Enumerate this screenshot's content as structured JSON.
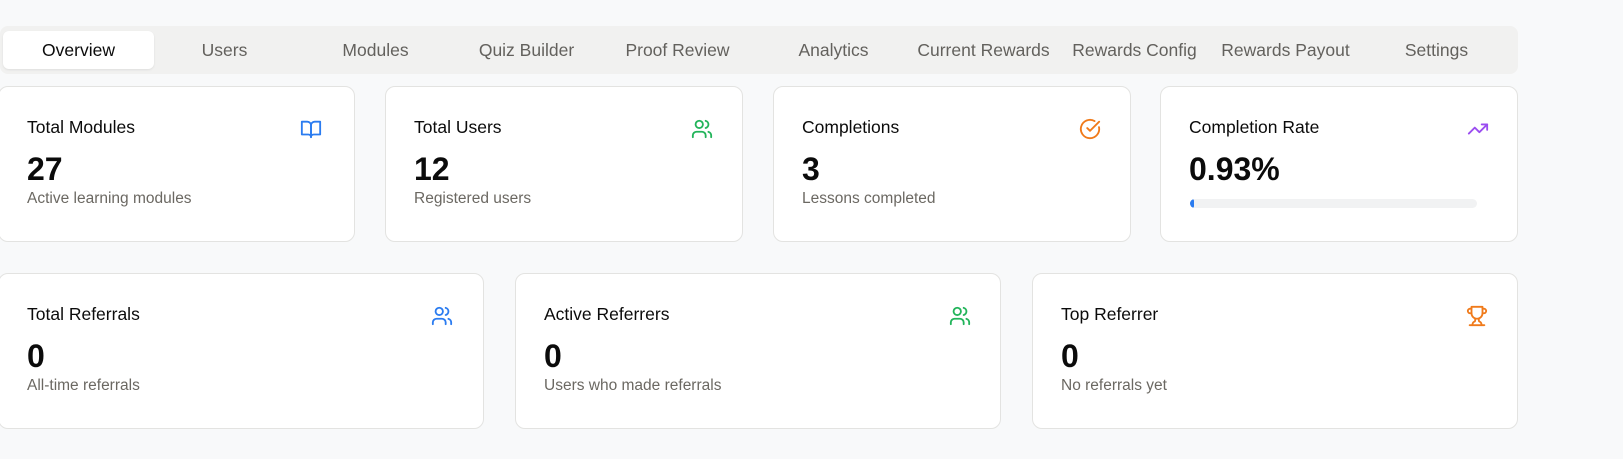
{
  "tabs": [
    {
      "label": "Overview"
    },
    {
      "label": "Users"
    },
    {
      "label": "Modules"
    },
    {
      "label": "Quiz Builder"
    },
    {
      "label": "Proof Review"
    },
    {
      "label": "Analytics"
    },
    {
      "label": "Current Rewards"
    },
    {
      "label": "Rewards Config"
    },
    {
      "label": "Rewards Payout"
    },
    {
      "label": "Settings"
    }
  ],
  "active_tab": "Overview",
  "stats": {
    "total_modules": {
      "title": "Total Modules",
      "value": "27",
      "subtitle": "Active learning modules",
      "icon": "book-open-icon",
      "color": "#2b7cf0"
    },
    "total_users": {
      "title": "Total Users",
      "value": "12",
      "subtitle": "Registered users",
      "icon": "users-icon",
      "color": "#22b45a"
    },
    "completions": {
      "title": "Completions",
      "value": "3",
      "subtitle": "Lessons completed",
      "icon": "circle-check-icon",
      "color": "#f07a1a"
    },
    "completion_rate": {
      "title": "Completion Rate",
      "value": "0.93%",
      "progress_percent": 0.93,
      "icon": "trending-up-icon",
      "color": "#9b4df0"
    }
  },
  "referrals": {
    "total_referrals": {
      "title": "Total Referrals",
      "value": "0",
      "subtitle": "All-time referrals",
      "icon": "users-icon",
      "color": "#2b7cf0"
    },
    "active_referrers": {
      "title": "Active Referrers",
      "value": "0",
      "subtitle": "Users who made referrals",
      "icon": "users-icon",
      "color": "#22b45a"
    },
    "top_referrer": {
      "title": "Top Referrer",
      "value": "0",
      "subtitle": "No referrals yet",
      "icon": "trophy-icon",
      "color": "#f07a1a"
    }
  },
  "colors": {
    "page_background": "#f8f9fa",
    "tabbar_background": "#f1f1f0",
    "progress_fill": "#2b7cf0"
  }
}
